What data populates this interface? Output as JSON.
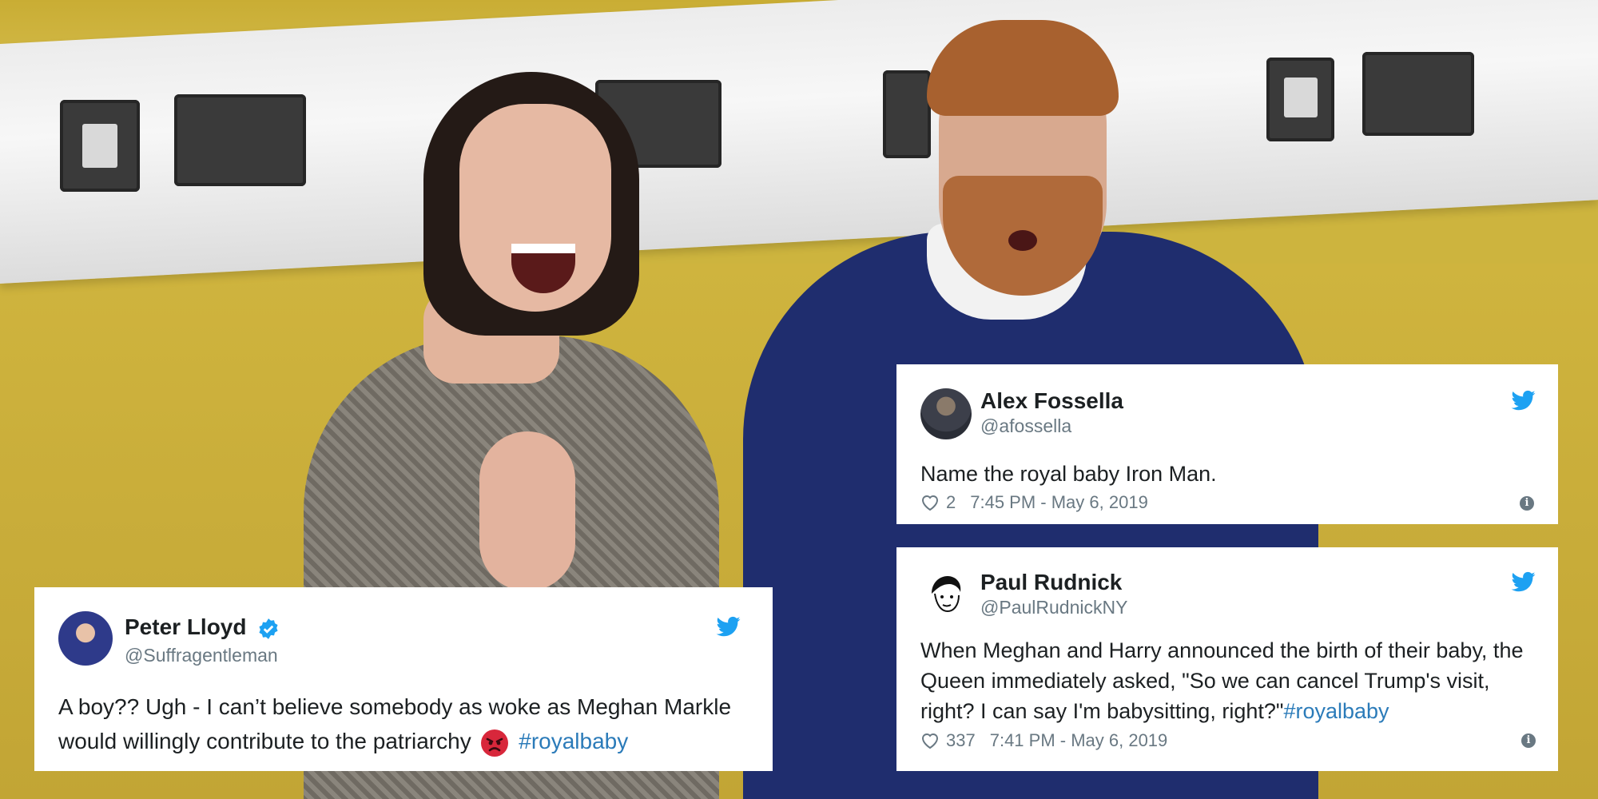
{
  "tweets": [
    {
      "name": "Alex Fossella",
      "handle": "@afossella",
      "text": "Name the royal baby Iron Man.",
      "likes": "2",
      "timestamp": "7:45 PM - May 6, 2019"
    },
    {
      "name": "Paul Rudnick",
      "handle": "@PaulRudnickNY",
      "text": "When Meghan and Harry announced the birth of their baby, the Queen immediately asked, \"So we can cancel Trump's visit, right? I can say I'm babysitting, right?\"",
      "hashtag": "#royalbaby",
      "likes": "337",
      "timestamp": "7:41 PM - May 6, 2019"
    },
    {
      "name": "Peter Lloyd",
      "handle": "@Suffragentleman",
      "verified": true,
      "text": "A boy?? Ugh - I can’t believe somebody as woke as Meghan Markle would willingly contribute to the patriarchy",
      "hashtag": "#royalbaby"
    }
  ],
  "colors": {
    "twitter_blue": "#1da1f2",
    "hashtag": "#2b7bb9",
    "meta_gray": "#697882"
  },
  "icons": [
    "twitter-bird-icon",
    "heart-icon",
    "info-icon",
    "verified-badge-icon",
    "angry-face-emoji"
  ]
}
